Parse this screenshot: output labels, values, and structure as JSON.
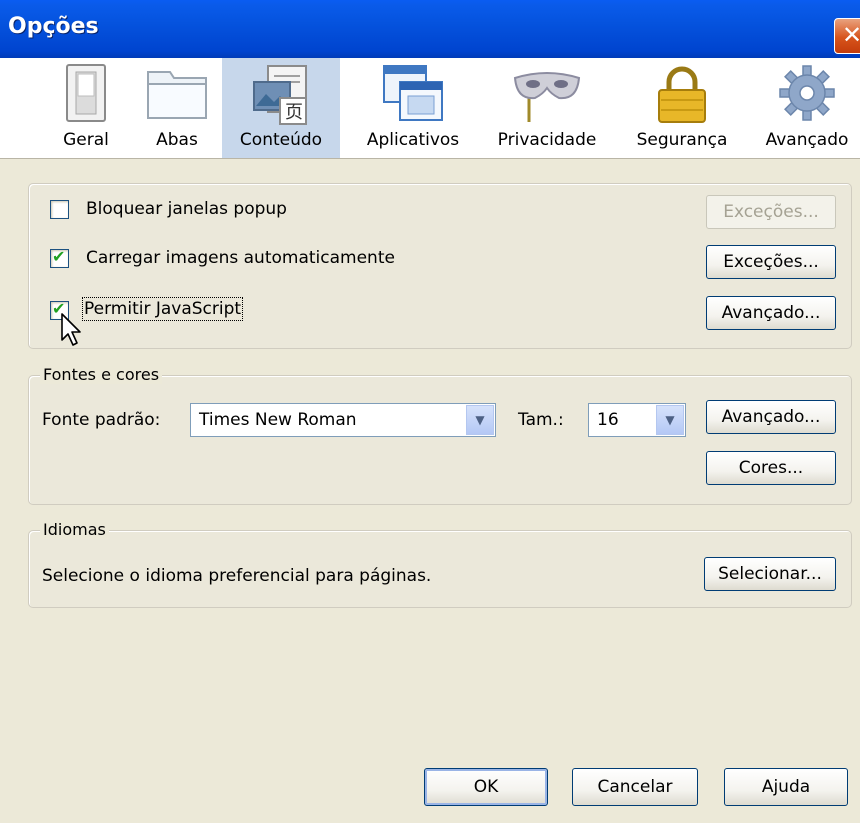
{
  "window": {
    "title": "Opções",
    "close_symbol": "✕"
  },
  "tabs": [
    {
      "label": "Geral",
      "icon": "light-switch-icon"
    },
    {
      "label": "Abas",
      "icon": "folder-tab-icon"
    },
    {
      "label": "Conteúdo",
      "icon": "content-document-icon",
      "selected": true
    },
    {
      "label": "Aplicativos",
      "icon": "applications-window-icon"
    },
    {
      "label": "Privacidade",
      "icon": "mask-icon"
    },
    {
      "label": "Segurança",
      "icon": "padlock-icon"
    },
    {
      "label": "Avançado",
      "icon": "gear-icon"
    }
  ],
  "content": {
    "popup": {
      "label": "Bloquear janelas popup",
      "checked": false,
      "exceptions_label": "Exceções...",
      "exceptions_enabled": false
    },
    "images": {
      "label": "Carregar imagens automaticamente",
      "checked": true,
      "exceptions_label": "Exceções..."
    },
    "javascript": {
      "label": "Permitir JavaScript",
      "checked": true,
      "advanced_label": "Avançado..."
    }
  },
  "fonts": {
    "group_label": "Fontes e cores",
    "default_font_label": "Fonte padrão:",
    "default_font_value": "Times New Roman",
    "size_label": "Tam.:",
    "size_value": "16",
    "advanced_label": "Avançado...",
    "colors_label": "Cores..."
  },
  "languages": {
    "group_label": "Idiomas",
    "description": "Selecione o idioma preferencial para páginas.",
    "select_label": "Selecionar..."
  },
  "footer": {
    "ok_label": "OK",
    "cancel_label": "Cancelar",
    "help_label": "Ajuda"
  },
  "colors": {
    "titlebar": "#0553de",
    "selected_tab": "#c7d7eb",
    "dialog_bg": "#ece9d8",
    "check_mark": "#21a121"
  }
}
